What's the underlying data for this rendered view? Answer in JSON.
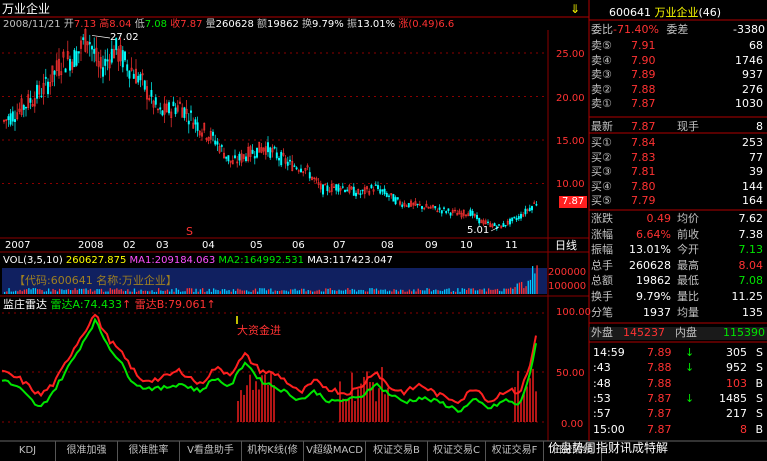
{
  "title": "万业企业",
  "info": {
    "date": "2008/11/21",
    "open_l": "开",
    "open": "7.13",
    "high_l": "高",
    "high": "8.04",
    "low_l": "低",
    "low": "7.08",
    "close_l": "收",
    "close": "7.87",
    "vol_l": "量",
    "vol": "260628",
    "amt_l": "额",
    "amt": "19862",
    "turn_l": "换",
    "turn": "9.79%",
    "amp_l": "振",
    "amp": "13.01%",
    "chg_l": "涨",
    "chg": "(0.49)6.6"
  },
  "price_axis": [
    "25.00",
    "20.00",
    "15.00",
    "10.00"
  ],
  "current_price": "7.87",
  "high_label": "27.02",
  "low_label": "5.01",
  "dates": [
    "2007",
    "2008",
    "02",
    "03",
    "04",
    "05",
    "06",
    "07",
    "08",
    "09",
    "10",
    "11"
  ],
  "period": "日线",
  "ma_marker": "S",
  "vol_legend": {
    "name": "VOL(3,5,10)",
    "v": "260627.875",
    "ma1": "MA1:209184.063",
    "ma2": "MA2:164992.531",
    "ma3": "MA3:117423.047"
  },
  "vol_axis": [
    "200000",
    "100000"
  ],
  "vol_watermark": "【代码:600641 名称:万业企业】",
  "osc_legend": {
    "name": "监庄雷达",
    "a": "雷达A:74.433",
    "b": "雷达B:79.061"
  },
  "osc_axis": [
    "100.00",
    "50.00",
    "0.00"
  ],
  "osc_note": "大资金进",
  "panel": {
    "code": "600641",
    "name": "万业企业",
    "code_suffix": "(46)",
    "wb_l": "委比",
    "wb": "-71.40%",
    "wc_l": "委差",
    "wc": "-3380",
    "sells": [
      {
        "l": "卖⑤",
        "p": "7.91",
        "v": "68"
      },
      {
        "l": "卖④",
        "p": "7.90",
        "v": "1746"
      },
      {
        "l": "卖③",
        "p": "7.89",
        "v": "937"
      },
      {
        "l": "卖②",
        "p": "7.88",
        "v": "276"
      },
      {
        "l": "卖①",
        "p": "7.87",
        "v": "1030"
      }
    ],
    "last_l": "最新",
    "last": "7.87",
    "hand_l": "现手",
    "hand": "8",
    "buys": [
      {
        "l": "买①",
        "p": "7.84",
        "v": "253"
      },
      {
        "l": "买②",
        "p": "7.83",
        "v": "77"
      },
      {
        "l": "买③",
        "p": "7.81",
        "v": "39"
      },
      {
        "l": "买④",
        "p": "7.80",
        "v": "144"
      },
      {
        "l": "买⑤",
        "p": "7.79",
        "v": "164"
      }
    ],
    "stats": [
      {
        "l1": "涨跌",
        "v1": "0.49",
        "l2": "均价",
        "v2": "7.62",
        "c1": "rd",
        "c2": "wh"
      },
      {
        "l1": "涨幅",
        "v1": "6.64%",
        "l2": "前收",
        "v2": "7.38",
        "c1": "rd",
        "c2": "wh"
      },
      {
        "l1": "振幅",
        "v1": "13.01%",
        "l2": "今开",
        "v2": "7.13",
        "c1": "wh",
        "c2": "gr"
      },
      {
        "l1": "总手",
        "v1": "260628",
        "l2": "最高",
        "v2": "8.04",
        "c1": "wh",
        "c2": "rd"
      },
      {
        "l1": "总额",
        "v1": "19862",
        "l2": "最低",
        "v2": "7.08",
        "c1": "wh",
        "c2": "gr"
      },
      {
        "l1": "换手",
        "v1": "9.79%",
        "l2": "量比",
        "v2": "11.25",
        "c1": "wh",
        "c2": "wh"
      },
      {
        "l1": "分笔",
        "v1": "1937",
        "l2": "均量",
        "v2": "135",
        "c1": "wh",
        "c2": "wh"
      }
    ],
    "outer_l": "外盘",
    "outer": "145237",
    "inner_l": "内盘",
    "inner": "115390",
    "ticks": [
      {
        "t": "14:59",
        "p": "7.89",
        "a": "↓",
        "v": "305",
        "s": "S",
        "pc": "rd",
        "ac": "gr",
        "vc": "wh",
        "sc": "wh"
      },
      {
        "t": ":43",
        "p": "7.88",
        "a": "↓",
        "v": "952",
        "s": "S",
        "pc": "rd",
        "ac": "gr",
        "vc": "wh",
        "sc": "wh"
      },
      {
        "t": ":48",
        "p": "7.88",
        "a": "",
        "v": "103",
        "s": "B",
        "pc": "rd",
        "ac": "gr",
        "vc": "rd",
        "sc": "wh"
      },
      {
        "t": ":53",
        "p": "7.87",
        "a": "↓",
        "v": "1485",
        "s": "S",
        "pc": "rd",
        "ac": "gr",
        "vc": "wh",
        "sc": "wh"
      },
      {
        "t": ":57",
        "p": "7.87",
        "a": "",
        "v": "217",
        "s": "S",
        "pc": "rd",
        "ac": "gr",
        "vc": "wh",
        "sc": "wh"
      },
      {
        "t": "15:00",
        "p": "7.87",
        "a": "",
        "v": "8",
        "s": "B",
        "pc": "rd",
        "ac": "gr",
        "vc": "rd",
        "sc": "wh"
      }
    ]
  },
  "tabs": [
    "KDJ",
    "很准加强",
    "很准胜率",
    "V看盘助手",
    "机构K线(修",
    "V超级MACD",
    "权证交易B",
    "权证交易C",
    "权证交易F",
    "日分隔线"
  ],
  "status_text": "价盘势周指财讯成特解",
  "colors": {
    "up": "#ff3232",
    "down": "#00ffff",
    "radar_a": "#00e600",
    "radar_b": "#ff2020",
    "grid": "#8b0000",
    "vol_bg": "#102060"
  }
}
